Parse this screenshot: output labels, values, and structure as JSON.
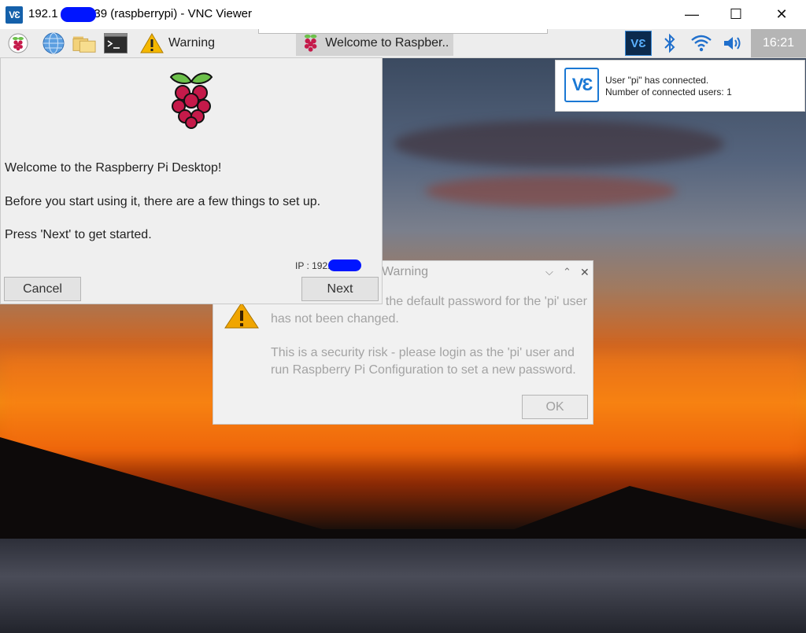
{
  "window": {
    "title": "192.1        .139 (raspberrypi) - VNC Viewer",
    "app_icon_label": "VƐ",
    "minimize": "—",
    "maximize": "☐",
    "close": "✕"
  },
  "taskbar": {
    "tasks": [
      {
        "label": "Warning"
      },
      {
        "label": "Welcome to Raspber..."
      }
    ],
    "clock": "16:21",
    "vnc_tray_label": "VƐ"
  },
  "welcome": {
    "line1": "Welcome to the Raspberry Pi Desktop!",
    "line2": "Before you start using it, there are a few things to set up.",
    "line3": "Press 'Next' to get started.",
    "ip": "IP : 192.             139",
    "cancel_label": "Cancel",
    "next_label": "Next"
  },
  "warning": {
    "title": "Warning",
    "msg1": "SSH is enabled and the default password for the 'pi' user",
    "msg2": "has not been changed.",
    "msg3": "This is a security risk - please login as the 'pi' user and",
    "msg4": "run Raspberry Pi Configuration to set a new password.",
    "ok_label": "OK"
  },
  "notification": {
    "logo": "VƐ",
    "line1": "User \"pi\" has connected.",
    "line2": "Number of connected users: 1"
  },
  "colors": {
    "accent": "#1a78d4",
    "redaction": "#0015ff",
    "raspberry": "#c51a4a",
    "leaf": "#6cc04a",
    "warning_yellow": "#f5b800"
  }
}
